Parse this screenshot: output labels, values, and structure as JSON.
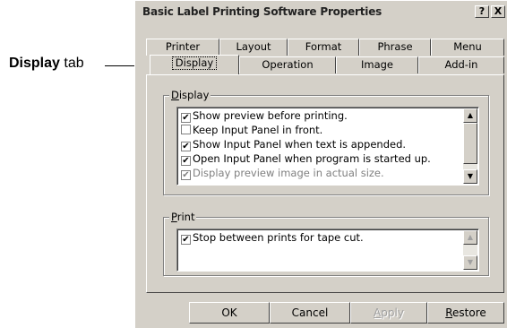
{
  "callout": {
    "bold": "Display",
    "rest": " tab"
  },
  "dialog": {
    "title": "Basic Label Printing Software Properties",
    "help_glyph": "?",
    "close_glyph": "X"
  },
  "tabs": {
    "row1": [
      "Printer",
      "Layout",
      "Format",
      "Phrase",
      "Menu"
    ],
    "row2": [
      "Display",
      "Operation",
      "Image",
      "Add-in"
    ],
    "active": "Display"
  },
  "display_group": {
    "label_first": "D",
    "label_rest": "isplay",
    "items": [
      {
        "label": "Show preview before printing.",
        "checked": true,
        "enabled": true,
        "mark": "✔"
      },
      {
        "label": "Keep Input Panel in front.",
        "checked": false,
        "enabled": true,
        "mark": ""
      },
      {
        "label": "Show Input Panel when text is appended.",
        "checked": true,
        "enabled": true,
        "mark": "✔"
      },
      {
        "label": "Open Input Panel when program is started up.",
        "checked": true,
        "enabled": true,
        "mark": "✔"
      },
      {
        "label": "Display preview image in actual size.",
        "checked": true,
        "enabled": false,
        "mark": "✔"
      }
    ],
    "scroll_up": "▲",
    "scroll_down": "▼"
  },
  "print_group": {
    "label_first": "P",
    "label_rest": "rint",
    "items": [
      {
        "label": "Stop between prints for tape cut.",
        "checked": true,
        "enabled": true,
        "mark": "✔"
      }
    ],
    "scroll_up": "▲",
    "scroll_down": "▼"
  },
  "buttons": {
    "ok": "OK",
    "cancel": "Cancel",
    "apply_first": "A",
    "apply_rest": "pply",
    "restore_first": "R",
    "restore_rest": "estore"
  }
}
